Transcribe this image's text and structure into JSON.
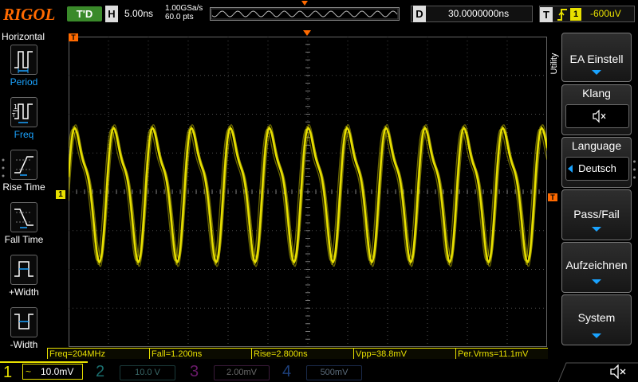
{
  "brand": "RIGOL",
  "run_state": "T'D",
  "timebase": {
    "letter": "H",
    "value": "5.00ns"
  },
  "acquisition": {
    "sample_rate": "1.00GSa/s",
    "memory": "60.0 pts"
  },
  "delay": {
    "letter": "D",
    "value": "30.0000000ns"
  },
  "trigger": {
    "letter": "T",
    "source": "1",
    "level": "-600uV"
  },
  "left_menu": {
    "title": "Horizontal",
    "items": [
      {
        "label": "Period"
      },
      {
        "label": "Freq"
      },
      {
        "label": "Rise Time"
      },
      {
        "label": "Fall Time"
      },
      {
        "label": "+Width"
      },
      {
        "label": "-Width"
      }
    ]
  },
  "right_menu": {
    "tab_label": "Utility",
    "ea_label": "EA Einstell",
    "sound_title": "Klang",
    "language_title": "Language",
    "language_value": "Deutsch",
    "passfail_label": "Pass/Fail",
    "record_label": "Aufzeichnen",
    "system_label": "System"
  },
  "markers": {
    "trigger_pos": "T",
    "ch1_offset": "1",
    "trig_level": "T"
  },
  "measurements": [
    {
      "text": "Freq=204MHz"
    },
    {
      "text": "Fall=1.200ns"
    },
    {
      "text": "Rise=2.800ns"
    },
    {
      "text": "Vpp=38.8mV"
    },
    {
      "text": "Per.Vrms=11.1mV"
    }
  ],
  "channels": [
    {
      "num": "1",
      "coupling": "~",
      "scale": "10.0mV",
      "color": "#e8e000",
      "active": true
    },
    {
      "num": "2",
      "scale": "10.0 V",
      "color": "#1fb8b8",
      "active": false
    },
    {
      "num": "3",
      "scale": "2.00mV",
      "color": "#c020c0",
      "active": false
    },
    {
      "num": "4",
      "scale": "500mV",
      "color": "#2a6fd6",
      "active": false
    }
  ],
  "colors": {
    "ch1": "#e8e000",
    "accent": "#1aa3ff",
    "brand": "#ff6a00",
    "run": "#3a8a2a"
  },
  "icons": [
    "period-icon",
    "freq-icon",
    "rise-time-icon",
    "fall-time-icon",
    "pos-width-icon",
    "neg-width-icon",
    "mute-icon",
    "sound-icon"
  ]
}
